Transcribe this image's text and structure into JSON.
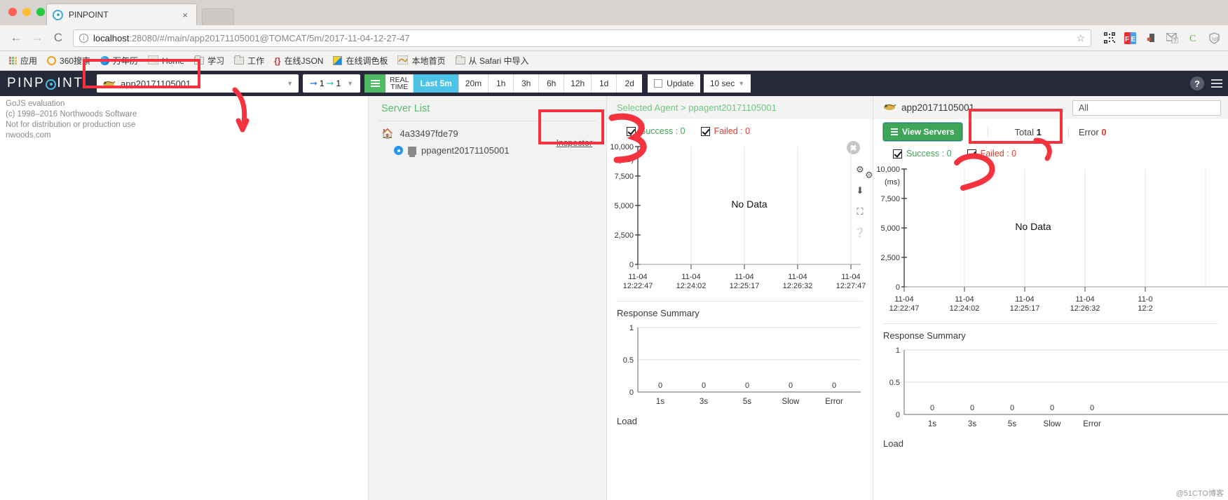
{
  "browser": {
    "tab_title": "PINPOINT",
    "tab_close": "×",
    "back": "←",
    "forward": "→",
    "reload": "C",
    "url_host": "localhost",
    "url_path": ":28080/#/main/app20171105001@TOMCAT/5m/2017-11-04-12-27-47",
    "info_glyph": "i",
    "star_glyph": "☆",
    "extensions": [
      "qr-code-icon",
      "fe-icon",
      "evernote-icon",
      "gmail-icon",
      "c-icon",
      "shield-icon"
    ],
    "bookmarks": [
      {
        "label": "应用",
        "icon": "apps-grid-icon"
      },
      {
        "label": "360搜索",
        "icon": "circle-orange-icon"
      },
      {
        "label": "万年历",
        "icon": "moz-icon"
      },
      {
        "label": "Home",
        "icon": "home-icon"
      },
      {
        "label": "学习",
        "icon": "folder-icon"
      },
      {
        "label": "工作",
        "icon": "folder-icon"
      },
      {
        "label": "在线JSON",
        "icon": "json-icon"
      },
      {
        "label": "在线调色板",
        "icon": "palette-icon"
      },
      {
        "label": "本地首页",
        "icon": "home-icon"
      },
      {
        "label": "从 Safari 中导入",
        "icon": "folder-icon"
      }
    ]
  },
  "pinpoint": {
    "logo": {
      "part1": "PINP",
      "part2": "INT"
    },
    "app_select": {
      "value": "app20171105001",
      "icon": "tomcat-icon",
      "caret": "▼"
    },
    "node_counts": {
      "inbound": "1",
      "outbound": "1",
      "caret": "▼"
    },
    "server_map_button": "list-view-icon",
    "time_buttons": [
      {
        "label": "REAL TIME",
        "active": false,
        "id": "realtime"
      },
      {
        "label": "Last 5m",
        "active": true
      },
      {
        "label": "20m",
        "active": false
      },
      {
        "label": "1h",
        "active": false
      },
      {
        "label": "3h",
        "active": false
      },
      {
        "label": "6h",
        "active": false
      },
      {
        "label": "12h",
        "active": false
      },
      {
        "label": "1d",
        "active": false
      },
      {
        "label": "2d",
        "active": false
      }
    ],
    "update": {
      "label": "Update",
      "checked": false
    },
    "refresh_interval": {
      "label": "10 sec",
      "caret": "▼"
    },
    "help": "?"
  },
  "gojs_watermark": {
    "line1": "GoJS evaluation",
    "line2": "(c) 1998–2016 Northwoods Software",
    "line3": "Not for distribution or production use",
    "line4": "nwoods.com"
  },
  "server_list": {
    "title": "Server List",
    "host": "4a33497fde79",
    "agent": "ppagent20171105001",
    "inspector_link": "Inspector"
  },
  "agent_panel": {
    "selected_agent_label": "Selected Agent > ppagent20171105001",
    "close": "✖",
    "filters": [
      {
        "label": "Success : 0",
        "checked": true,
        "color": "#3fa558"
      },
      {
        "label": "Failed : 0",
        "checked": true,
        "color": "#e03c31"
      }
    ],
    "side_icons": [
      "gear-icon",
      "download-icon",
      "expand-icon",
      "help-icon"
    ],
    "response_summary_label": "Response Summary",
    "load_label": "Load"
  },
  "app_panel": {
    "app_name": "app20171105001",
    "app_icon": "tomcat-icon",
    "all_select": "All",
    "view_servers_button": "View Servers",
    "total_label": "Total",
    "total_value": "1",
    "error_label": "Error",
    "error_value": "0",
    "filters": [
      {
        "label": "Success : 0",
        "checked": true,
        "color": "#3fa558"
      },
      {
        "label": "Failed : 0",
        "checked": true,
        "color": "#e03c31"
      }
    ],
    "side_icons": [
      "gear-icon"
    ],
    "response_summary_label": "Response Summary",
    "load_label": "Load"
  },
  "annotations": {
    "marks": [
      {
        "type": "box",
        "target": "app-select"
      },
      {
        "type": "box",
        "target": "inspector"
      },
      {
        "type": "box",
        "target": "view-servers"
      },
      {
        "type": "stroke",
        "label": "3"
      },
      {
        "type": "stroke",
        "label": "2"
      },
      {
        "type": "stroke",
        "label": "arrow-down"
      }
    ],
    "color": "#f5333f",
    "watermark": "@51CTO博客"
  },
  "chart_data": [
    {
      "id": "agent-scatter",
      "type": "scatter",
      "title": "",
      "no_data_label": "No Data",
      "ylabel": "(ms)",
      "ylim": [
        0,
        10000
      ],
      "yticks": [
        "0",
        "2,500",
        "5,000",
        "7,500",
        "10,000"
      ],
      "xticks": [
        {
          "date": "11-04",
          "time": "12:22:47"
        },
        {
          "date": "11-04",
          "time": "12:24:02"
        },
        {
          "date": "11-04",
          "time": "12:25:17"
        },
        {
          "date": "11-04",
          "time": "12:26:32"
        },
        {
          "date": "11-04",
          "time": "12:27:47"
        }
      ],
      "series": [
        {
          "name": "Success",
          "values": []
        },
        {
          "name": "Failed",
          "values": []
        }
      ],
      "grid": true
    },
    {
      "id": "agent-response-summary",
      "type": "bar",
      "title": "Response Summary",
      "categories": [
        "1s",
        "3s",
        "5s",
        "Slow",
        "Error"
      ],
      "values": [
        0,
        0,
        0,
        0,
        0
      ],
      "data_labels": [
        "0",
        "0",
        "0",
        "0",
        "0"
      ],
      "ylim": [
        0,
        1
      ],
      "yticks": [
        "0",
        "0.5",
        "1"
      ],
      "grid": true
    },
    {
      "id": "app-scatter",
      "type": "scatter",
      "title": "",
      "no_data_label": "No Data",
      "ylabel": "(ms)",
      "ylim": [
        0,
        10000
      ],
      "yticks": [
        "0",
        "2,500",
        "5,000",
        "7,500",
        "10,000"
      ],
      "xticks": [
        {
          "date": "11-04",
          "time": "12:22:47"
        },
        {
          "date": "11-04",
          "time": "12:24:02"
        },
        {
          "date": "11-04",
          "time": "12:25:17"
        },
        {
          "date": "11-04",
          "time": "12:26:32"
        },
        {
          "date": "11-0",
          "time": "12:2"
        }
      ],
      "series": [
        {
          "name": "Success",
          "values": []
        },
        {
          "name": "Failed",
          "values": []
        }
      ],
      "grid": true
    },
    {
      "id": "app-response-summary",
      "type": "bar",
      "title": "Response Summary",
      "categories": [
        "1s",
        "3s",
        "5s",
        "Slow",
        "Error"
      ],
      "values": [
        0,
        0,
        0,
        0,
        0
      ],
      "data_labels": [
        "0",
        "0",
        "0",
        "0",
        "0"
      ],
      "ylim": [
        0,
        1
      ],
      "yticks": [
        "0",
        "0.5",
        "1"
      ],
      "grid": true
    }
  ]
}
